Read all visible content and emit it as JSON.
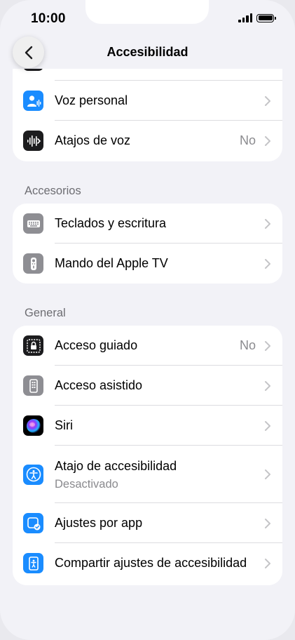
{
  "status": {
    "time": "10:00"
  },
  "nav": {
    "title": "Accesibilidad"
  },
  "group_top": {
    "rows": [
      {
        "label": "Voz personal",
        "value": ""
      },
      {
        "label": "Atajos de voz",
        "value": "No"
      }
    ]
  },
  "accessories": {
    "header": "Accesorios",
    "rows": [
      {
        "label": "Teclados y escritura",
        "value": ""
      },
      {
        "label": "Mando del Apple TV",
        "value": ""
      }
    ]
  },
  "general": {
    "header": "General",
    "rows": [
      {
        "label": "Acceso guiado",
        "value": "No"
      },
      {
        "label": "Acceso asistido",
        "value": ""
      },
      {
        "label": "Siri",
        "value": ""
      },
      {
        "label": "Atajo de accesibilidad",
        "sublabel": "Desactivado",
        "value": ""
      },
      {
        "label": "Ajustes por app",
        "value": ""
      },
      {
        "label": "Compartir ajustes de accesibilidad",
        "value": ""
      }
    ]
  },
  "icons": {
    "back": "chevron-left-icon",
    "personal_voice": "person-waveform-icon",
    "vocal_shortcuts": "waveform-icon",
    "keyboards": "keyboard-icon",
    "apple_tv_remote": "remote-icon",
    "guided_access": "lock-icon",
    "assistive_access": "assistive-access-icon",
    "siri": "siri-icon",
    "accessibility_shortcut": "accessibility-icon",
    "per_app": "per-app-settings-icon",
    "share_settings": "share-accessibility-icon"
  },
  "colors": {
    "accent_blue": "#1a8cff",
    "background": "#f2f2f7",
    "secondary_text": "#8a8a8e"
  }
}
